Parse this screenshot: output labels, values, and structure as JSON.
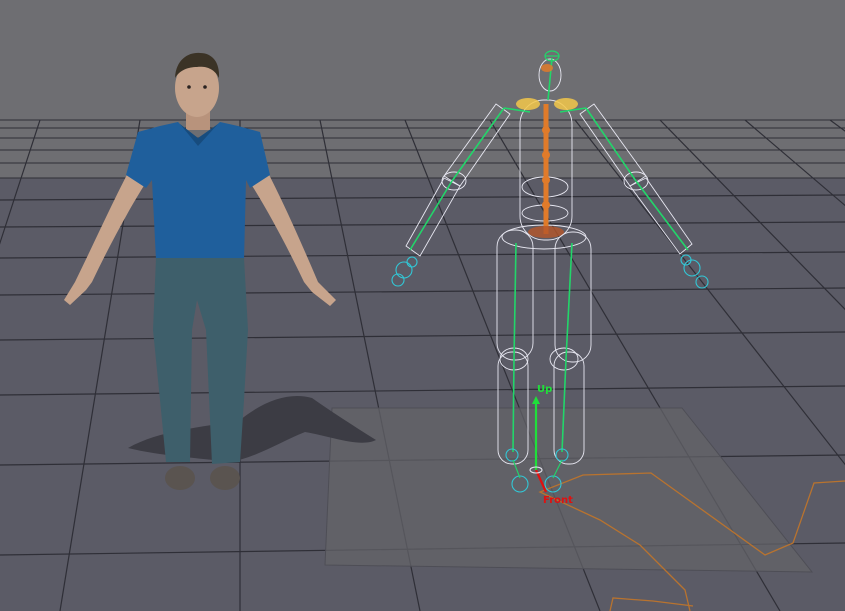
{
  "viewport": {
    "background_color": "#6e6e72",
    "floor_color": "#5b5b66",
    "grid_line_color": "#2f2f37",
    "selection_plane_color": "#636368",
    "path_curve_color": "#b8732f"
  },
  "skeleton": {
    "bone_color": "#22d66a",
    "capsule_color": "#e8e8f2",
    "spine_color": "#e07b2a",
    "joint_color": "#32c7d6",
    "root_color": "#f3c84a"
  },
  "character": {
    "shirt_color": "#1f5f9c",
    "jeans_color": "#3e5f6b",
    "skin_color": "#c7a48c",
    "hair_color": "#3b3326"
  },
  "gizmo": {
    "up_label": "Up",
    "front_label": "Front",
    "up_color": "#1fe03a",
    "front_color": "#e01010"
  }
}
